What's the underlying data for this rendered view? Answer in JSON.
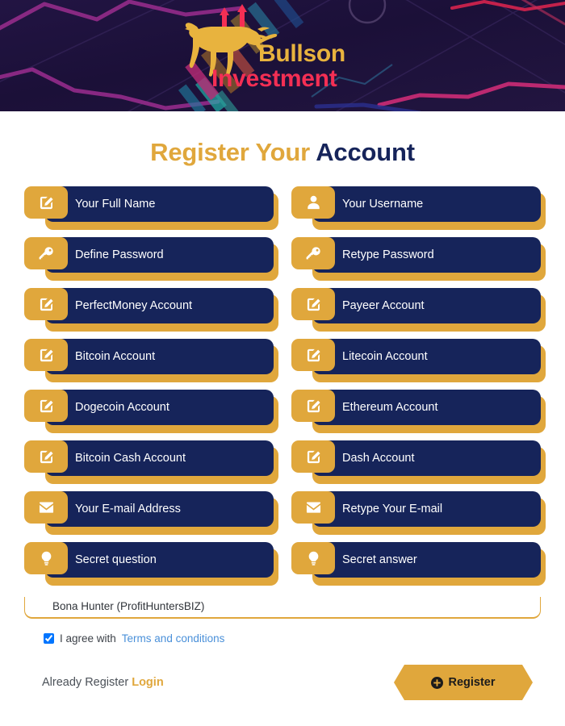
{
  "header": {
    "brand_line1": "Bullson",
    "brand_line2": "Investment",
    "logo_icon": "bull-logo",
    "bg_color": "#1d1139",
    "gold": "#e8b33e",
    "pink": "#f42f54"
  },
  "main": {
    "title_gold": "Register Your",
    "title_navy": " Account"
  },
  "fields": [
    {
      "placeholder": "Your Full Name",
      "icon": "edit-pencil-icon"
    },
    {
      "placeholder": "Your Username",
      "icon": "user-icon"
    },
    {
      "placeholder": "Define Password",
      "icon": "key-icon"
    },
    {
      "placeholder": "Retype Password",
      "icon": "key-icon"
    },
    {
      "placeholder": "PerfectMoney Account",
      "icon": "edit-pencil-icon"
    },
    {
      "placeholder": "Payeer Account",
      "icon": "edit-pencil-icon"
    },
    {
      "placeholder": "Bitcoin Account",
      "icon": "edit-pencil-icon"
    },
    {
      "placeholder": "Litecoin Account",
      "icon": "edit-pencil-icon"
    },
    {
      "placeholder": "Dogecoin Account",
      "icon": "edit-pencil-icon"
    },
    {
      "placeholder": "Ethereum Account",
      "icon": "edit-pencil-icon"
    },
    {
      "placeholder": "Bitcoin Cash Account",
      "icon": "edit-pencil-icon"
    },
    {
      "placeholder": "Dash Account",
      "icon": "edit-pencil-icon"
    },
    {
      "placeholder": "Your E-mail Address",
      "icon": "envelope-icon"
    },
    {
      "placeholder": "Retype Your E-mail",
      "icon": "envelope-icon"
    },
    {
      "placeholder": "Secret question",
      "icon": "lightbulb-icon"
    },
    {
      "placeholder": "Secret answer",
      "icon": "lightbulb-icon"
    }
  ],
  "sponsor": {
    "value": "Bona Hunter (ProfitHuntersBIZ)",
    "placeholder": "Bona Hunter (ProfitHuntersBIZ)"
  },
  "agree": {
    "checked": true,
    "text": "I agree with",
    "link": "Terms and conditions",
    "link_color": "#4a90d9"
  },
  "footer": {
    "already_text": "Already Register",
    "login_label": "Login",
    "register_label": "Register",
    "register_icon": "plus-circle-icon",
    "accent": "#e0a73c"
  },
  "colors": {
    "gold": "#e0a73c",
    "navy": "#16245a",
    "white": "#ffffff"
  }
}
